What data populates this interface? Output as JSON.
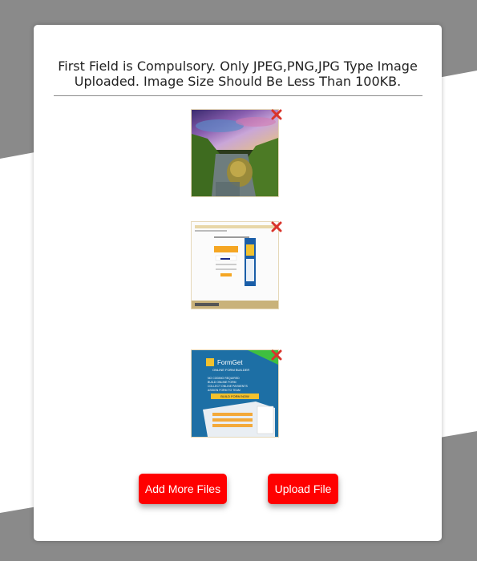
{
  "notice": {
    "line1": "First Field is Compulsory. Only JPEG,PNG,JPG Type Image",
    "line2": "Uploaded. Image Size Should Be Less Than 100KB."
  },
  "previews": [
    {
      "image": "landscape-river-photo",
      "remove_icon": "close-icon"
    },
    {
      "image": "webpage-screenshot",
      "remove_icon": "close-icon"
    },
    {
      "image": "formget-banner",
      "remove_icon": "close-icon",
      "banner_title": "FormGet",
      "banner_subtitle": "ONLINE FORM BUILDER",
      "banner_points": [
        "NO CODING REQUIRED",
        "BUILD ONLINE FORM",
        "COLLECT ONLINE PAYMENTS",
        "ASSIGN FORM TO TEAM"
      ],
      "banner_button": "BUILD FORM NOW"
    }
  ],
  "buttons": {
    "add_more": "Add More Files",
    "upload": "Upload File"
  },
  "colors": {
    "button_bg": "#ff0000",
    "page_bg": "#8a8a8a",
    "close_icon": "#d9342b"
  }
}
